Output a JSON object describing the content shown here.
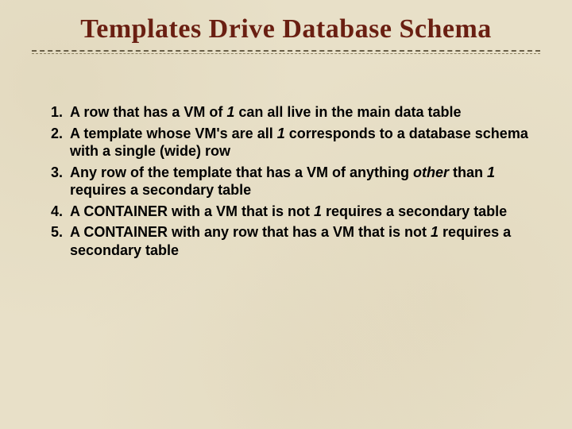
{
  "slide": {
    "title": "Templates Drive Database Schema",
    "items": [
      {
        "pre": "A row that has a VM of ",
        "em1": "1",
        "mid": " can all live in the main data table",
        "em2": "",
        "post": ""
      },
      {
        "pre": "A template whose VM's are all ",
        "em1": "1",
        "mid": " corresponds to a database schema with a single (wide) row",
        "em2": "",
        "post": ""
      },
      {
        "pre": "Any row of the template that has a VM of anything ",
        "em1": "other",
        "mid": " than ",
        "em2": "1",
        "post": " requires a secondary table"
      },
      {
        "pre": "A CONTAINER with a VM that is not ",
        "em1": "1",
        "mid": " requires a secondary table",
        "em2": "",
        "post": ""
      },
      {
        "pre": "A CONTAINER with any row that has a VM that is not ",
        "em1": "1",
        "mid": " requires a secondary table",
        "em2": "",
        "post": ""
      }
    ]
  }
}
